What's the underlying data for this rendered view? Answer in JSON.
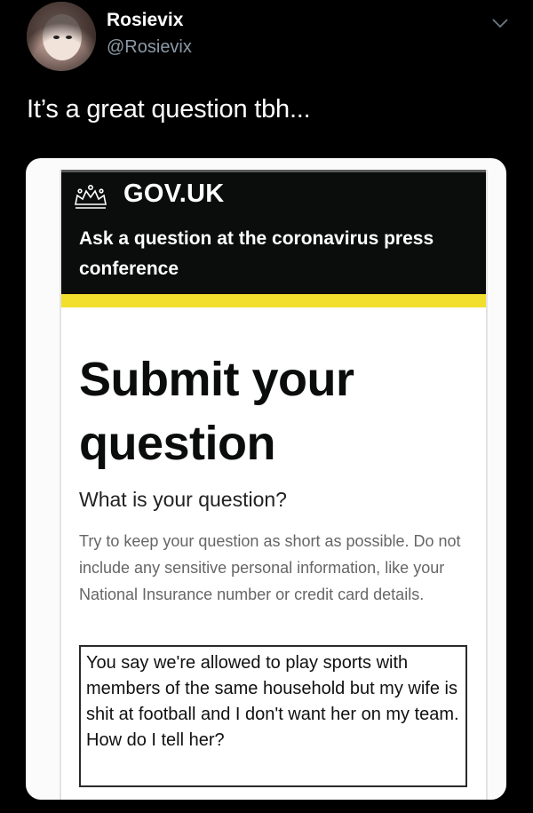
{
  "tweet": {
    "display_name": "Rosievix",
    "handle": "@Rosievix",
    "text": "It’s a great question tbh..."
  },
  "screenshot": {
    "header": {
      "logo_text": "GOV.UK",
      "service_name": "Ask a question at the coronavirus press conference",
      "background": "#0b0c0c",
      "accent_bar": "#f2de2c"
    },
    "heading": "Submit your question",
    "question_label": "What is your question?",
    "hint": "Try to keep your question as short as possible. Do not include any sensitive personal information, like your National Insurance number or credit card details.",
    "question_value": "You say we're allowed to play sports with members of the same household but my wife is shit at football and I don't want her on my team. How do I tell her?"
  },
  "icons": {
    "avatar": "user-avatar",
    "menu": "chevron-down-icon",
    "crown": "crown-icon"
  }
}
